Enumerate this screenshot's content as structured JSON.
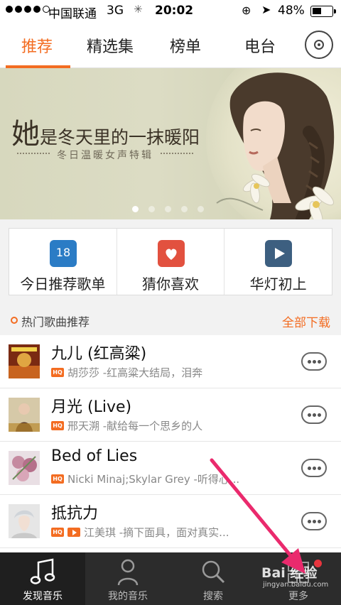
{
  "status_bar": {
    "carrier": "中国联通",
    "network": "3G",
    "time": "20:02",
    "battery_percent": "48%",
    "battery_level": 0.48,
    "signal_dots_filled": 4
  },
  "tabs": [
    {
      "label": "推荐",
      "active": true
    },
    {
      "label": "精选集",
      "active": false
    },
    {
      "label": "榜单",
      "active": false
    },
    {
      "label": "电台",
      "active": false
    }
  ],
  "tab_icons": {
    "record": "vinyl-disc-icon"
  },
  "banner": {
    "title_big": "她",
    "title_rest": "是冬天里的一抹暖阳",
    "subtitle": "冬日温暖女声特辑",
    "slides_total": 5,
    "slide_active": 1
  },
  "quick_actions": [
    {
      "label": "今日推荐歌单",
      "icon": "calendar-icon",
      "icon_text": "18",
      "color": "#2b7cc5"
    },
    {
      "label": "猜你喜欢",
      "icon": "heart-icon",
      "color": "#e2513f"
    },
    {
      "label": "华灯初上",
      "icon": "play-icon",
      "color": "#3d5f80"
    }
  ],
  "hot_section": {
    "title": "热门歌曲推荐",
    "download_all": "全部下载"
  },
  "songs": [
    {
      "title": "九儿 (红高粱)",
      "badge": "HQ",
      "mv": false,
      "subtitle": "胡莎莎 -红高粱大结局，泪奔"
    },
    {
      "title": "月光 (Live)",
      "badge": "HQ",
      "mv": false,
      "subtitle": "邢天溯 -献给每一个思乡的人"
    },
    {
      "title": "Bed of Lies",
      "badge": "HQ",
      "mv": false,
      "subtitle": "Nicki Minaj;Skylar Grey -听得心..."
    },
    {
      "title": "抵抗力",
      "badge": "HQ",
      "mv": true,
      "subtitle": "江美琪 -摘下面具，面对真实..."
    }
  ],
  "bottom_tabs": [
    {
      "label": "发现音乐",
      "icon": "music-note-icon",
      "active": true
    },
    {
      "label": "我的音乐",
      "icon": "person-icon",
      "active": false
    },
    {
      "label": "搜索",
      "icon": "search-icon",
      "active": false
    },
    {
      "label": "更多",
      "icon": "grid-icon",
      "active": false
    }
  ],
  "watermark": {
    "text": "Bai 经验",
    "url": "jingyan.baidu.com"
  },
  "colors": {
    "accent": "#f36c21",
    "bottom_bar": "#2c2c2c",
    "annotation_arrow": "#ea2a6d",
    "badge_dot": "#e8353e"
  }
}
